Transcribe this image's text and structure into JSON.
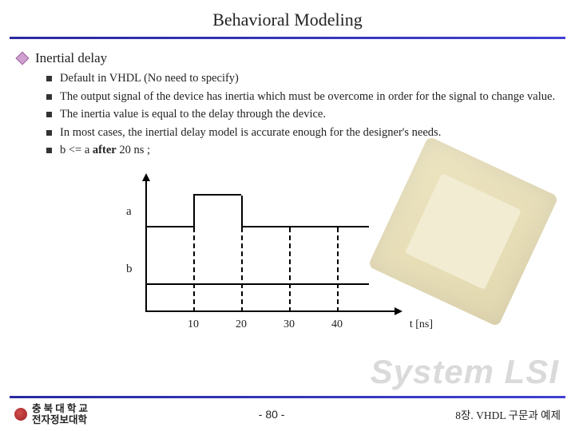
{
  "title": "Behavioral Modeling",
  "section": "Inertial delay",
  "bullets": [
    "Default in VHDL (No need to specify)",
    "The output signal of the device has inertia which must be overcome in order for the signal to change value.",
    "The inertia value is equal to the delay through the device.",
    "In most cases, the inertial delay model is accurate enough for the designer's needs."
  ],
  "code_line": {
    "prefix": "b <= a ",
    "after": "after",
    "suffix": " 20 ns ;"
  },
  "diagram": {
    "sig_a": "a",
    "sig_b": "b",
    "ticks": [
      "10",
      "20",
      "30",
      "40"
    ],
    "axis_label": "t [ns]"
  },
  "watermark": "System LSI",
  "footer": {
    "uni_line1": "충 북 대 학 교",
    "uni_line2": "전자정보대학",
    "page": "- 80 -",
    "chapter": "8장. VHDL 구문과 예제"
  }
}
